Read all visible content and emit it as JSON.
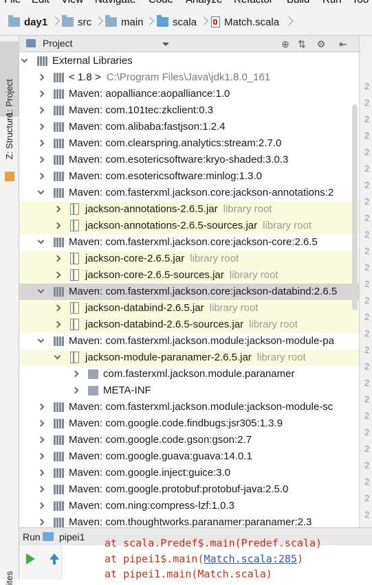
{
  "menu": [
    "File",
    "Edit",
    "View",
    "Navigate",
    "Code",
    "Analyze",
    "Refactor",
    "Build",
    "Run",
    "Too"
  ],
  "breadcrumbs": [
    "day1",
    "src",
    "main",
    "scala",
    "Match.scala"
  ],
  "side_tabs": {
    "project": "1: Project",
    "structure": "Z: Structure",
    "bottom": "ites"
  },
  "panel": {
    "title": "Project"
  },
  "tree": [
    {
      "label": "External Libraries",
      "arrow": "down",
      "level": 0,
      "icon": "lib"
    },
    {
      "label": "< 1.8 >",
      "extra": "C:\\Program Files\\Java\\jdk1.8.0_161",
      "arrow": "right",
      "level": 1,
      "icon": "lib"
    },
    {
      "label": "Maven: aopalliance:aopalliance:1.0",
      "arrow": "right",
      "level": 1,
      "icon": "lib"
    },
    {
      "label": "Maven: com.101tec:zkclient:0.3",
      "arrow": "right",
      "level": 1,
      "icon": "lib"
    },
    {
      "label": "Maven: com.alibaba:fastjson:1.2.4",
      "arrow": "right",
      "level": 1,
      "icon": "lib"
    },
    {
      "label": "Maven: com.clearspring.analytics:stream:2.7.0",
      "arrow": "right",
      "level": 1,
      "icon": "lib"
    },
    {
      "label": "Maven: com.esotericsoftware:kryo-shaded:3.0.3",
      "arrow": "right",
      "level": 1,
      "icon": "lib"
    },
    {
      "label": "Maven: com.esotericsoftware:minlog:1.3.0",
      "arrow": "right",
      "level": 1,
      "icon": "lib"
    },
    {
      "label": "Maven: com.fasterxml.jackson.core:jackson-annotations:2",
      "arrow": "down",
      "level": 1,
      "icon": "lib"
    },
    {
      "label": "jackson-annotations-2.6.5.jar",
      "sub": "library root",
      "arrow": "right",
      "level": 2,
      "icon": "jar",
      "hl": true
    },
    {
      "label": "jackson-annotations-2.6.5-sources.jar",
      "sub": "library root",
      "arrow": "right",
      "level": 2,
      "icon": "jar",
      "hl": true
    },
    {
      "label": "Maven: com.fasterxml.jackson.core:jackson-core:2.6.5",
      "arrow": "down",
      "level": 1,
      "icon": "lib"
    },
    {
      "label": "jackson-core-2.6.5.jar",
      "sub": "library root",
      "arrow": "right",
      "level": 2,
      "icon": "jar",
      "hl": true
    },
    {
      "label": "jackson-core-2.6.5-sources.jar",
      "sub": "library root",
      "arrow": "right",
      "level": 2,
      "icon": "jar",
      "hl": true
    },
    {
      "label": "Maven: com.fasterxml.jackson.core:jackson-databind:2.6.5",
      "arrow": "down",
      "level": 1,
      "icon": "lib",
      "sel": true
    },
    {
      "label": "jackson-databind-2.6.5.jar",
      "sub": "library root",
      "arrow": "right",
      "level": 2,
      "icon": "jar",
      "hl": true
    },
    {
      "label": "jackson-databind-2.6.5-sources.jar",
      "sub": "library root",
      "arrow": "right",
      "level": 2,
      "icon": "jar",
      "hl": true
    },
    {
      "label": "Maven: com.fasterxml.jackson.module:jackson-module-pa",
      "arrow": "down",
      "level": 1,
      "icon": "lib"
    },
    {
      "label": "jackson-module-paranamer-2.6.5.jar",
      "sub": "library root",
      "arrow": "down",
      "level": 2,
      "icon": "jar",
      "hl": true
    },
    {
      "label": "com.fasterxml.jackson.module.paranamer",
      "arrow": "right",
      "level": 3,
      "icon": "pkg"
    },
    {
      "label": "META-INF",
      "arrow": "right",
      "level": 3,
      "icon": "pkg"
    },
    {
      "label": "Maven: com.fasterxml.jackson.module:jackson-module-sc",
      "arrow": "right",
      "level": 1,
      "icon": "lib"
    },
    {
      "label": "Maven: com.google.code.findbugs:jsr305:1.3.9",
      "arrow": "right",
      "level": 1,
      "icon": "lib"
    },
    {
      "label": "Maven: com.google.code.gson:gson:2.7",
      "arrow": "right",
      "level": 1,
      "icon": "lib"
    },
    {
      "label": "Maven: com.google.guava:guava:14.0.1",
      "arrow": "right",
      "level": 1,
      "icon": "lib"
    },
    {
      "label": "Maven: com.google.inject:guice:3.0",
      "arrow": "right",
      "level": 1,
      "icon": "lib"
    },
    {
      "label": "Maven: com.google.protobuf:protobuf-java:2.5.0",
      "arrow": "right",
      "level": 1,
      "icon": "lib"
    },
    {
      "label": "Maven: com.ning:compress-lzf:1.0.3",
      "arrow": "right",
      "level": 1,
      "icon": "lib"
    },
    {
      "label": "Maven: com.thoughtworks.paranamer:paranamer:2.3",
      "arrow": "right",
      "level": 1,
      "icon": "lib"
    }
  ],
  "gutter": [
    "2",
    "2",
    "2",
    "2",
    "2",
    "2",
    "2",
    "2",
    "2",
    "2",
    "2",
    "2",
    "2",
    "2",
    "2",
    "2",
    "2",
    "2",
    "2",
    "2",
    "2",
    "2",
    "2",
    "2",
    "2",
    "2",
    "2",
    "2",
    "2"
  ],
  "run": {
    "label": "Run",
    "config": "pipei1",
    "lines": [
      {
        "pre": "at scala.Predef$.main(Predef.scala)",
        "link": "",
        "post": ""
      },
      {
        "pre": "at pipei1$.main(",
        "link": "Match.scala:285",
        "post": ")"
      },
      {
        "pre": "at pipei1.main(Match.scala)",
        "link": "",
        "post": ""
      }
    ]
  }
}
